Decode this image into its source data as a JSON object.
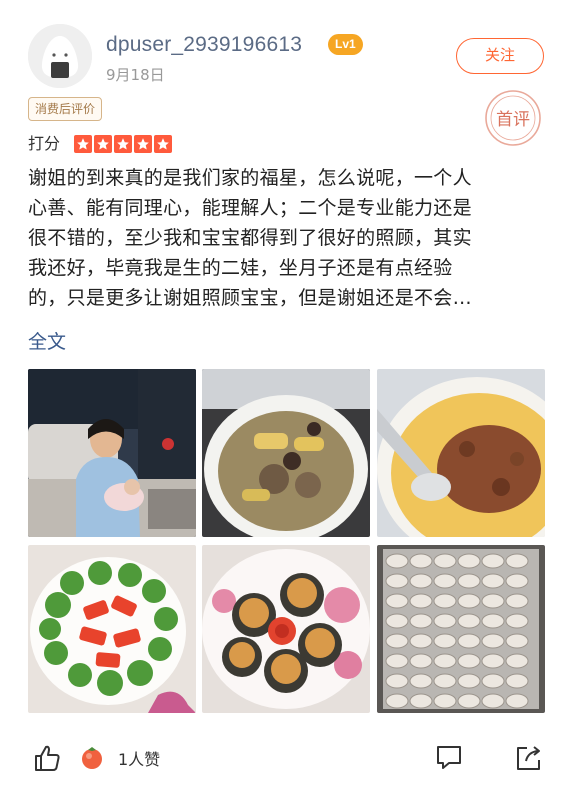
{
  "author": {
    "username": "dpuser_2939196613",
    "level": "Lv1",
    "date": "9月18日",
    "follow_label": "关注"
  },
  "tags": {
    "consumed": "消费后评价",
    "first_review_stamp": "首评"
  },
  "rating": {
    "label": "打分",
    "stars": 5
  },
  "review": {
    "lines": [
      "谢姐的到来真的是我们家的福星，怎么说呢，一个人",
      "心善、能有同理心，能理解人；二个是专业能力还是",
      "很不错的，至少我和宝宝都得到了很好的照顾，其实",
      "我还好，毕竟我是生的二娃，坐月子还是有点经验",
      "的，只是更多让谢姐照顾宝宝，但是谢姐还是不会…"
    ],
    "full_text_link": "全文"
  },
  "photos": [
    {
      "subject": "mother-holding-baby-photo"
    },
    {
      "subject": "corn-soup-photo"
    },
    {
      "subject": "steamed-egg-photo"
    },
    {
      "subject": "broccoli-tomato-photo"
    },
    {
      "subject": "stuffed-mushroom-photo"
    },
    {
      "subject": "dumplings-photo"
    }
  ],
  "actions": {
    "like_count_label": "1人赞"
  },
  "colors": {
    "accent": "#ff6633",
    "link": "#3a5a8c",
    "username": "#5b6b85",
    "level_badge": "#f6a623",
    "star": "#ff5a3c"
  }
}
